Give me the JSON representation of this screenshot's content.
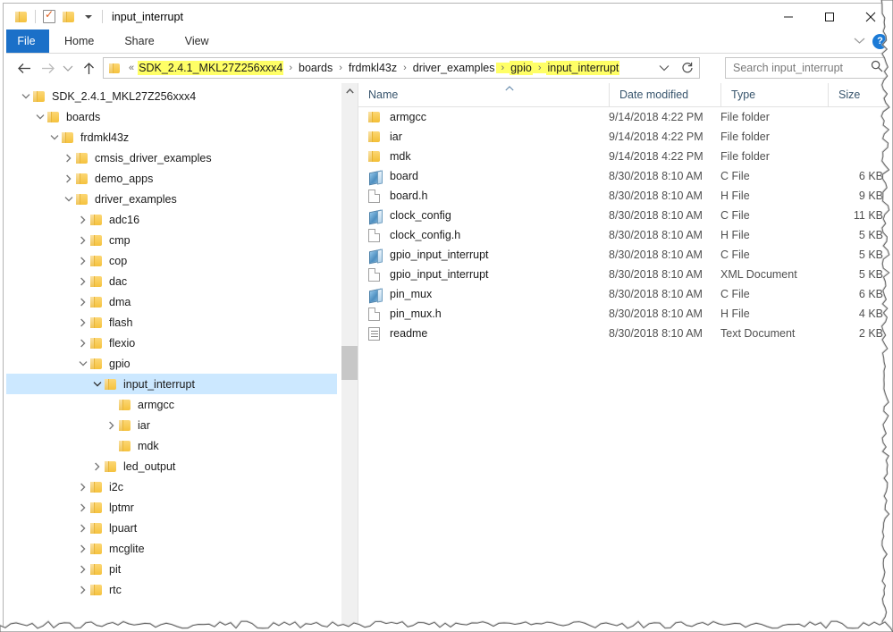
{
  "window": {
    "title": "input_interrupt",
    "quick_access": [
      {
        "name": "folder-icon",
        "label": "Folder"
      },
      {
        "name": "properties-icon",
        "label": "Properties"
      },
      {
        "name": "new-folder-icon",
        "label": "New folder"
      },
      {
        "name": "customize-caret-icon",
        "label": "Customize Quick Access Toolbar"
      }
    ],
    "controls": {
      "minimize": "Minimize",
      "maximize": "Maximize",
      "close": "Close"
    }
  },
  "ribbon": {
    "tabs": [
      {
        "label": "File",
        "active": true
      },
      {
        "label": "Home",
        "active": false
      },
      {
        "label": "Share",
        "active": false
      },
      {
        "label": "View",
        "active": false
      }
    ],
    "collapse_label": "Minimize the Ribbon",
    "help_label": "?"
  },
  "address_bar": {
    "back_label": "Back",
    "forward_label": "Forward",
    "recent_label": "Recent locations",
    "up_label": "Up",
    "breadcrumb_root": "«",
    "crumbs": [
      {
        "label": "SDK_2.4.1_MKL27Z256xxx4",
        "highlight": true
      },
      {
        "label": "boards",
        "highlight": false
      },
      {
        "label": "frdmkl43z",
        "highlight": false
      },
      {
        "label": "driver_examples",
        "highlight": false
      },
      {
        "label": "gpio",
        "highlight": true
      },
      {
        "label": "input_interrupt",
        "highlight": true
      }
    ],
    "highlight_color": "#ffff66",
    "dropdown_label": "Previous locations",
    "refresh_label": "Refresh"
  },
  "search": {
    "value": "",
    "placeholder": "Search input_interrupt"
  },
  "nav_tree": {
    "selected_color": "#cce8ff",
    "items": [
      {
        "label": "SDK_2.4.1_MKL27Z256xxx4",
        "depth": 1,
        "state": "expanded",
        "selected": false
      },
      {
        "label": "boards",
        "depth": 2,
        "state": "expanded",
        "selected": false
      },
      {
        "label": "frdmkl43z",
        "depth": 3,
        "state": "expanded",
        "selected": false
      },
      {
        "label": "cmsis_driver_examples",
        "depth": 4,
        "state": "collapsed",
        "selected": false
      },
      {
        "label": "demo_apps",
        "depth": 4,
        "state": "collapsed",
        "selected": false
      },
      {
        "label": "driver_examples",
        "depth": 4,
        "state": "expanded",
        "selected": false
      },
      {
        "label": "adc16",
        "depth": 5,
        "state": "collapsed",
        "selected": false
      },
      {
        "label": "cmp",
        "depth": 5,
        "state": "collapsed",
        "selected": false
      },
      {
        "label": "cop",
        "depth": 5,
        "state": "collapsed",
        "selected": false
      },
      {
        "label": "dac",
        "depth": 5,
        "state": "collapsed",
        "selected": false
      },
      {
        "label": "dma",
        "depth": 5,
        "state": "collapsed",
        "selected": false
      },
      {
        "label": "flash",
        "depth": 5,
        "state": "collapsed",
        "selected": false
      },
      {
        "label": "flexio",
        "depth": 5,
        "state": "collapsed",
        "selected": false
      },
      {
        "label": "gpio",
        "depth": 5,
        "state": "expanded",
        "selected": false
      },
      {
        "label": "input_interrupt",
        "depth": 6,
        "state": "expanded",
        "selected": true
      },
      {
        "label": "armgcc",
        "depth": 7,
        "state": "leaf",
        "selected": false
      },
      {
        "label": "iar",
        "depth": 7,
        "state": "collapsed",
        "selected": false
      },
      {
        "label": "mdk",
        "depth": 7,
        "state": "leaf",
        "selected": false
      },
      {
        "label": "led_output",
        "depth": 6,
        "state": "collapsed",
        "selected": false
      },
      {
        "label": "i2c",
        "depth": 5,
        "state": "collapsed",
        "selected": false
      },
      {
        "label": "lptmr",
        "depth": 5,
        "state": "collapsed",
        "selected": false
      },
      {
        "label": "lpuart",
        "depth": 5,
        "state": "collapsed",
        "selected": false
      },
      {
        "label": "mcglite",
        "depth": 5,
        "state": "collapsed",
        "selected": false
      },
      {
        "label": "pit",
        "depth": 5,
        "state": "collapsed",
        "selected": false
      },
      {
        "label": "rtc",
        "depth": 5,
        "state": "collapsed",
        "selected": false
      }
    ],
    "scrollbar": {
      "up_arrow": "∧"
    }
  },
  "file_list": {
    "columns": [
      {
        "label": "Name",
        "sorted": "ascending"
      },
      {
        "label": "Date modified",
        "sorted": ""
      },
      {
        "label": "Type",
        "sorted": ""
      },
      {
        "label": "Size",
        "sorted": ""
      }
    ],
    "rows": [
      {
        "name": "armgcc",
        "date": "9/14/2018 4:22 PM",
        "type": "File folder",
        "size": "",
        "icon": "folder-icon"
      },
      {
        "name": "iar",
        "date": "9/14/2018 4:22 PM",
        "type": "File folder",
        "size": "",
        "icon": "folder-icon"
      },
      {
        "name": "mdk",
        "date": "9/14/2018 4:22 PM",
        "type": "File folder",
        "size": "",
        "icon": "folder-icon"
      },
      {
        "name": "board",
        "date": "8/30/2018 8:10 AM",
        "type": "C File",
        "size": "6 KB",
        "icon": "c-file-icon"
      },
      {
        "name": "board.h",
        "date": "8/30/2018 8:10 AM",
        "type": "H File",
        "size": "9 KB",
        "icon": "h-file-icon"
      },
      {
        "name": "clock_config",
        "date": "8/30/2018 8:10 AM",
        "type": "C File",
        "size": "11 KB",
        "icon": "c-file-icon"
      },
      {
        "name": "clock_config.h",
        "date": "8/30/2018 8:10 AM",
        "type": "H File",
        "size": "5 KB",
        "icon": "h-file-icon"
      },
      {
        "name": "gpio_input_interrupt",
        "date": "8/30/2018 8:10 AM",
        "type": "C File",
        "size": "5 KB",
        "icon": "c-file-icon"
      },
      {
        "name": "gpio_input_interrupt",
        "date": "8/30/2018 8:10 AM",
        "type": "XML Document",
        "size": "5 KB",
        "icon": "xml-file-icon"
      },
      {
        "name": "pin_mux",
        "date": "8/30/2018 8:10 AM",
        "type": "C File",
        "size": "6 KB",
        "icon": "c-file-icon"
      },
      {
        "name": "pin_mux.h",
        "date": "8/30/2018 8:10 AM",
        "type": "H File",
        "size": "4 KB",
        "icon": "h-file-icon"
      },
      {
        "name": "readme",
        "date": "8/30/2018 8:10 AM",
        "type": "Text Document",
        "size": "2 KB",
        "icon": "text-file-icon"
      }
    ]
  }
}
